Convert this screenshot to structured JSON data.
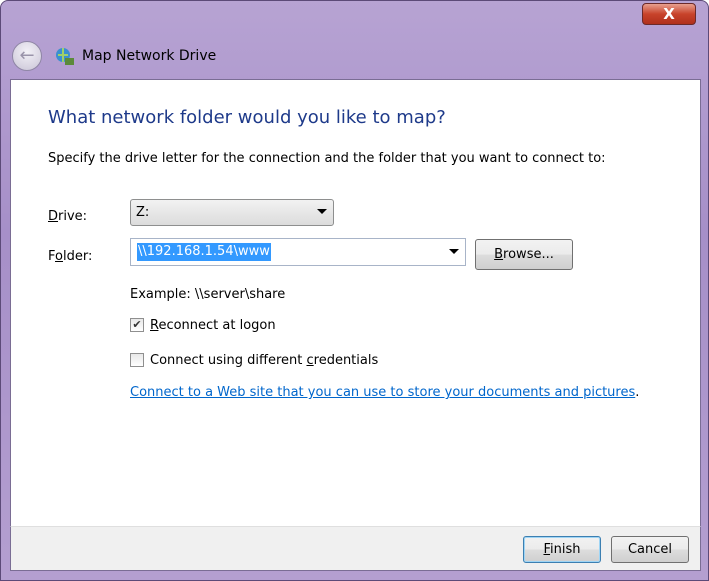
{
  "window": {
    "title": "Map Network Drive",
    "close_label": "X"
  },
  "heading": "What network folder would you like to map?",
  "description": "Specify the drive letter for the connection and the folder that you want to connect to:",
  "drive": {
    "label_prefix": "",
    "label_accel": "D",
    "label_rest": "rive:",
    "value": "Z:"
  },
  "folder": {
    "label_prefix": "F",
    "label_accel": "o",
    "label_rest": "lder:",
    "value": "\\\\192.168.1.54\\www"
  },
  "browse": {
    "accel": "B",
    "rest": "rowse..."
  },
  "example": "Example: \\\\server\\share",
  "reconnect": {
    "accel": "R",
    "rest": "econnect at logon",
    "checked": true
  },
  "credentials": {
    "prefix": "Connect using different ",
    "accel": "c",
    "rest": "redentials",
    "checked": false
  },
  "link": {
    "text": "Connect to a Web site that you can use to store your documents and pictures",
    "suffix": "."
  },
  "finish": {
    "accel": "F",
    "rest": "inish"
  },
  "cancel": "Cancel"
}
